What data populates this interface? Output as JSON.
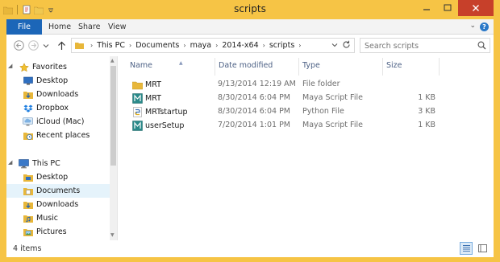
{
  "window": {
    "title": "scripts",
    "accent_color": "#f6c445",
    "close_color": "#c7402a"
  },
  "quick_access": {
    "icons": [
      "folder-icon",
      "properties-icon",
      "new-folder-icon",
      "customize-toolbar-icon"
    ]
  },
  "ribbon": {
    "tabs": [
      {
        "label": "File"
      },
      {
        "label": "Home"
      },
      {
        "label": "Share"
      },
      {
        "label": "View"
      }
    ]
  },
  "address": {
    "crumbs": [
      "This PC",
      "Documents",
      "maya",
      "2014-x64",
      "scripts"
    ]
  },
  "search": {
    "placeholder": "Search scripts"
  },
  "nav": {
    "items": [
      {
        "label": "Favorites",
        "icon": "star-icon",
        "level": 0
      },
      {
        "label": "Desktop",
        "icon": "desktop-icon",
        "level": 1
      },
      {
        "label": "Downloads",
        "icon": "downloads-icon",
        "level": 1
      },
      {
        "label": "Dropbox",
        "icon": "dropbox-icon",
        "level": 1
      },
      {
        "label": "iCloud (Mac)",
        "icon": "icloud-icon",
        "level": 1
      },
      {
        "label": "Recent places",
        "icon": "recent-places-icon",
        "level": 1
      },
      {
        "label": "This PC",
        "icon": "computer-icon",
        "level": 0
      },
      {
        "label": "Desktop",
        "icon": "desktop-folder-icon",
        "level": 1
      },
      {
        "label": "Documents",
        "icon": "documents-folder-icon",
        "level": 1,
        "selected": true
      },
      {
        "label": "Downloads",
        "icon": "downloads-folder-icon",
        "level": 1
      },
      {
        "label": "Music",
        "icon": "music-folder-icon",
        "level": 1
      },
      {
        "label": "Pictures",
        "icon": "pictures-folder-icon",
        "level": 1
      }
    ]
  },
  "columns": {
    "name": "Name",
    "date": "Date modified",
    "type": "Type",
    "size": "Size"
  },
  "files": [
    {
      "name": "MRT",
      "date": "9/13/2014 12:19 AM",
      "type": "File folder",
      "size": "",
      "icon": "folder-icon"
    },
    {
      "name": "MRT",
      "date": "8/30/2014 6:04 PM",
      "type": "Maya Script File",
      "size": "1 KB",
      "icon": "maya-script-icon"
    },
    {
      "name": "MRTstartup",
      "date": "8/30/2014 6:04 PM",
      "type": "Python File",
      "size": "3 KB",
      "icon": "python-file-icon"
    },
    {
      "name": "userSetup",
      "date": "7/20/2014 1:01 PM",
      "type": "Maya Script File",
      "size": "1 KB",
      "icon": "maya-script-icon"
    }
  ],
  "status": {
    "item_count": "4 items"
  }
}
